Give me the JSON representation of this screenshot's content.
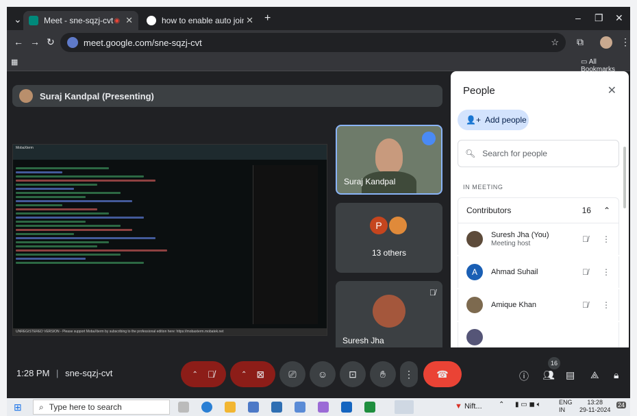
{
  "browser": {
    "tabs": [
      {
        "title": "Meet - sne-sqzj-cvt"
      },
      {
        "title": "how to enable auto join in goo"
      }
    ],
    "url": "meet.google.com/sne-sqzj-cvt",
    "all_bookmarks": "All Bookmarks"
  },
  "meet": {
    "presenting_label": "Suraj Kandpal (Presenting)",
    "screen_editor_title": "MobaXterm",
    "unregistered_notice": "UNREGISTERED VERSION  -  Please support MobaXterm by subscribing to the professional edition here:  https://mobaxterm.mobatek.net",
    "tiles": {
      "suraj": "Suraj Kandpal",
      "others_label": "13 others",
      "others_initial": "P",
      "suresh": "Suresh Jha"
    },
    "meeting_time": "1:28 PM",
    "meeting_code": "sne-sqzj-cvt",
    "people_count_badge": "16"
  },
  "people_panel": {
    "title": "People",
    "add_people": "Add people",
    "search_placeholder": "Search for people",
    "section": "IN MEETING",
    "contributors_label": "Contributors",
    "contributors_count": "16",
    "people": [
      {
        "name": "Suresh Jha (You)",
        "sub": "Meeting host",
        "color": "#5d4b3a"
      },
      {
        "name": "Ahmad Suhail",
        "initial": "A",
        "color": "#1a5fb4"
      },
      {
        "name": "Amique Khan",
        "color": "#7d6a4f"
      }
    ]
  },
  "taskbar": {
    "search_placeholder": "Type here to search",
    "nifty": "Nift...",
    "lang": "ENG",
    "region": "IN",
    "clock_time": "13:28",
    "clock_date": "29-11-2024",
    "notif_count": "24"
  }
}
